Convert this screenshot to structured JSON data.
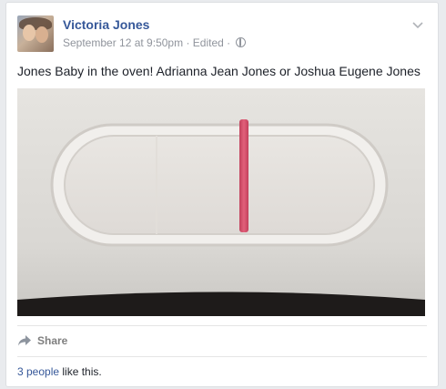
{
  "post": {
    "author": "Victoria Jones",
    "date": "September 12 at 9:50pm",
    "edited": "Edited",
    "separator": "·",
    "text": "Jones Baby in the oven! Adrianna Jean Jones or Joshua Eugene Jones",
    "photo_description_icon": "pregnancy-test-photo"
  },
  "actions": {
    "share_label": "Share"
  },
  "likes": {
    "people_link": "3 people",
    "suffix": " like this."
  },
  "colors": {
    "link": "#365899",
    "meta": "#90949c",
    "test_line": "#d9546e"
  }
}
